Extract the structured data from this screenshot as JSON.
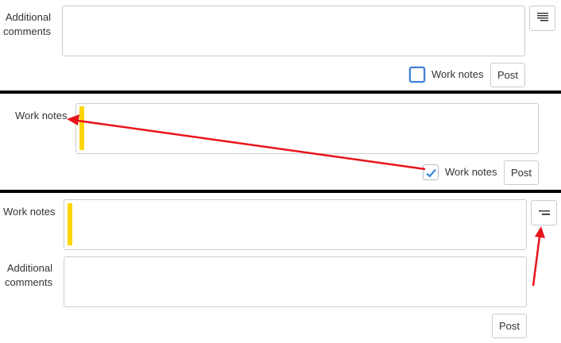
{
  "panel1": {
    "comments_label": "Additional comments",
    "worknotes_checkbox_label": "Work notes",
    "post_label": "Post",
    "worknotes_checked": false
  },
  "panel2": {
    "worknotes_label": "Work notes",
    "worknotes_checkbox_label": "Work notes",
    "post_label": "Post",
    "worknotes_checked": true
  },
  "panel3": {
    "worknotes_label": "Work notes",
    "comments_label": "Additional comments",
    "post_label": "Post"
  },
  "colors": {
    "annotation_arrow": "#e8141b",
    "worknotes_marker": "#ffd500",
    "checkbox_focus": "#3f7fd8",
    "checkmark": "#2f7fd4"
  },
  "icons": {
    "panel1_toggle": "multiple-input-icon",
    "panel3_toggle": "single-input-icon",
    "check": "checkmark-icon"
  }
}
